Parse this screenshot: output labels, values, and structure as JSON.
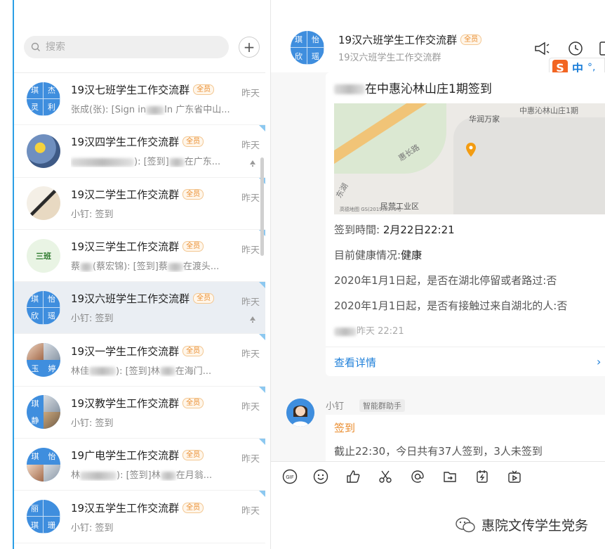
{
  "search": {
    "placeholder": "搜索"
  },
  "add_label": "+",
  "conversations": [
    {
      "title": "19汉七班学生工作交流群",
      "badge": "全员",
      "time": "昨天",
      "preview_prefix": "张成(张): [Sign in",
      "preview_suffix": "In 广东省中山...",
      "avatar": [
        "琪",
        "杰",
        "灵",
        "利"
      ]
    },
    {
      "title": "19汉四学生工作交流群",
      "badge": "全员",
      "time": "昨天",
      "preview_prefix": "",
      "preview_suffix": "): [签到]",
      "preview_tail": "在广东...",
      "avatar": []
    },
    {
      "title": "19汉二学生工作交流群",
      "badge": "全员",
      "time": "昨天",
      "preview": "小钉: 签到",
      "avatar": []
    },
    {
      "title": "19汉三学生工作交流群",
      "badge": "全员",
      "time": "昨天",
      "preview_prefix": "蔡",
      "preview_mid": "(蔡宏锦): [签到]蔡",
      "preview_tail": "在渡头...",
      "avatar_text": "三班"
    },
    {
      "title": "19汉六班学生工作交流群",
      "badge": "全员",
      "time": "昨天",
      "preview": "小钉: 签到",
      "avatar": [
        "琪",
        "怡",
        "欣",
        "瑶"
      ]
    },
    {
      "title": "19汉一学生工作交流群",
      "badge": "全员",
      "time": "昨天",
      "preview_prefix": "林佳",
      "preview_mid": "): [签到]林",
      "preview_tail": "在海门...",
      "avatar": [
        "",
        "",
        "玉",
        "婷"
      ]
    },
    {
      "title": "19汉教学生工作交流群",
      "badge": "全员",
      "time": "昨天",
      "preview": "小钉: 签到",
      "avatar": [
        "琪",
        "",
        "静",
        ""
      ]
    },
    {
      "title": "19广电学生工作交流群",
      "badge": "全员",
      "time": "昨天",
      "preview_prefix": "林",
      "preview_mid": "): [签到]林",
      "preview_tail": "在月翁...",
      "avatar": [
        "琪",
        "怡",
        "",
        ""
      ]
    },
    {
      "title": "19汉五学生工作交流群",
      "badge": "全员",
      "time": "昨天",
      "preview": "小钉: 签到",
      "avatar": [
        "丽",
        "",
        "琪",
        "珊"
      ]
    }
  ],
  "chat": {
    "title": "19汉六班学生工作交流群",
    "badge": "全员",
    "subtitle": "19汉六班学生工作交流群",
    "avatar": [
      "琪",
      "怡",
      "欣",
      "瑶"
    ],
    "ime": {
      "logo": "S",
      "lang": "中",
      "punct": "°,"
    }
  },
  "card": {
    "title_suffix": "在中惠沁林山庄1期签到",
    "map": {
      "label_top": "中惠沁林山庄1期",
      "label_shop": "华润万家",
      "label_road": "惠长路",
      "label_road2": "东湖",
      "label_area": "民营工业区",
      "copyright": "高德地图 GS(2019)6379号"
    },
    "checkin_label": "签到時間: ",
    "checkin_value": "2月22日22:21",
    "health_label": "目前健康情况:",
    "health_value": "健康",
    "q1": "2020年1月1日起，是否在湖北停留或者路过:否",
    "q2": "2020年1月1日起，是否有接触过来自湖北的人:否",
    "time": "昨天 22:21",
    "detail": "查看详情",
    "arrow": "›"
  },
  "bot": {
    "name": "小钉",
    "tag": "智能群助手",
    "line1": "签到",
    "line2": "截止22:30，今日共有37人签到，3人未签到"
  },
  "watermark": "惠院文传学生党务",
  "colors": {
    "accent": "#1e7fd9",
    "badge": "#e98a2a",
    "selected": "#eaeef3",
    "avatar": "#3f8ede"
  }
}
